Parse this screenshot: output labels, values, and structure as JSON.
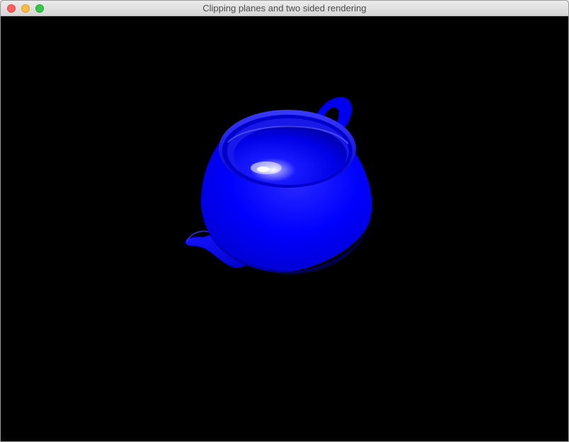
{
  "window": {
    "title": "Clipping planes and two sided rendering",
    "controls": [
      "close",
      "minimize",
      "zoom"
    ]
  },
  "scene": {
    "background_color": "#000000",
    "object": "teapot",
    "object_color": "#0000ff",
    "rendering": "two-sided with clipping plane (lid removed)"
  }
}
